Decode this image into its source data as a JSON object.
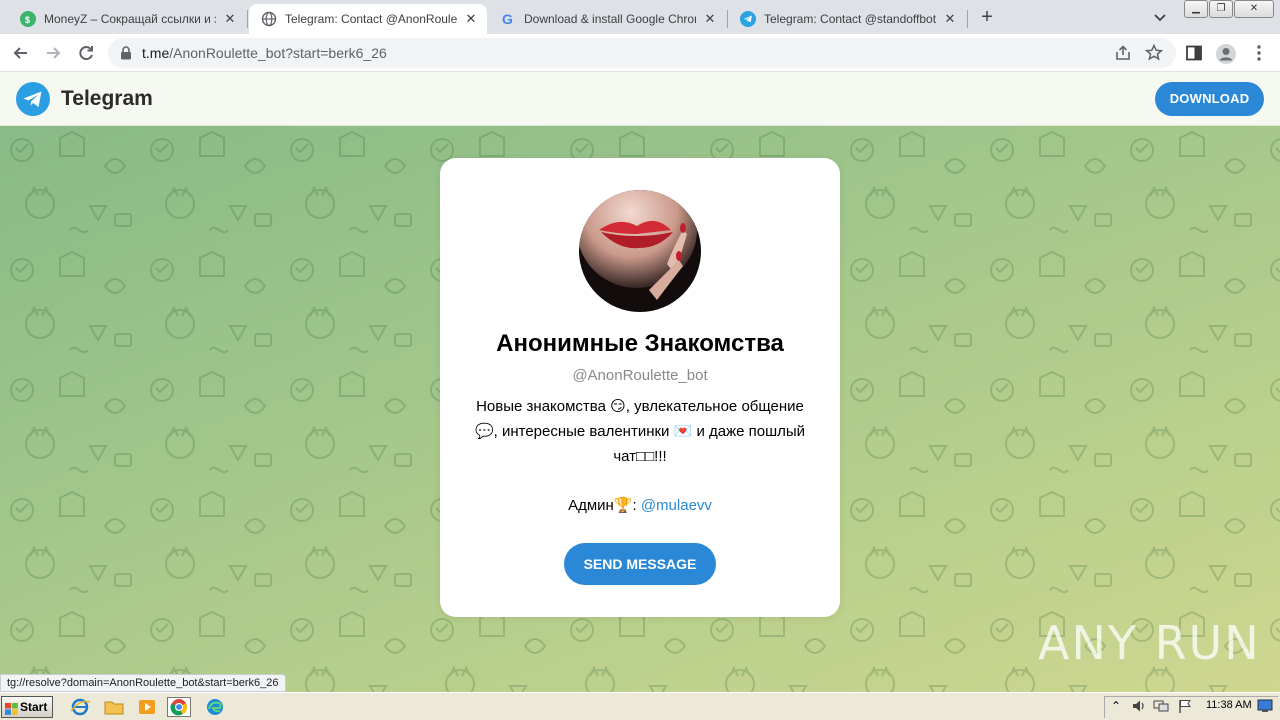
{
  "browser": {
    "tabs": [
      {
        "title": "MoneyZ – Сокращай ссылки и зарабатывай",
        "icon": "moneyz-favicon"
      },
      {
        "title": "Telegram: Contact @AnonRoulette_bot",
        "icon": "globe-favicon"
      },
      {
        "title": "Download & install Google Chrome - Google",
        "icon": "google-favicon"
      },
      {
        "title": "Telegram: Contact @standoffbot",
        "icon": "telegram-favicon"
      }
    ],
    "new_tab_label": "+",
    "url_host": "t.me",
    "url_path": "/AnonRoulette_bot?start=berk6_26"
  },
  "header": {
    "brand": "Telegram",
    "download_label": "DOWNLOAD"
  },
  "card": {
    "name": "Анонимные Знакомства",
    "username": "@AnonRoulette_bot",
    "desc_line1": "Новые знакомства 😏, увлекательное общение",
    "desc_line2": "💬, интересные валентинки 💌 и даже пошлый",
    "desc_line3": "чат□□!!!",
    "admin_prefix": "Админ🏆: ",
    "admin_mention": "@mulaevv",
    "send_label": "SEND MESSAGE"
  },
  "status_url": "tg://resolve?domain=AnonRoulette_bot&start=berk6_26",
  "watermark": "ANY RUN",
  "taskbar": {
    "start_label": "Start",
    "clock": "11:38 AM"
  },
  "colors": {
    "accent": "#2a88d6",
    "page_bg_start": "#86b886",
    "page_bg_end": "#cfd790"
  }
}
